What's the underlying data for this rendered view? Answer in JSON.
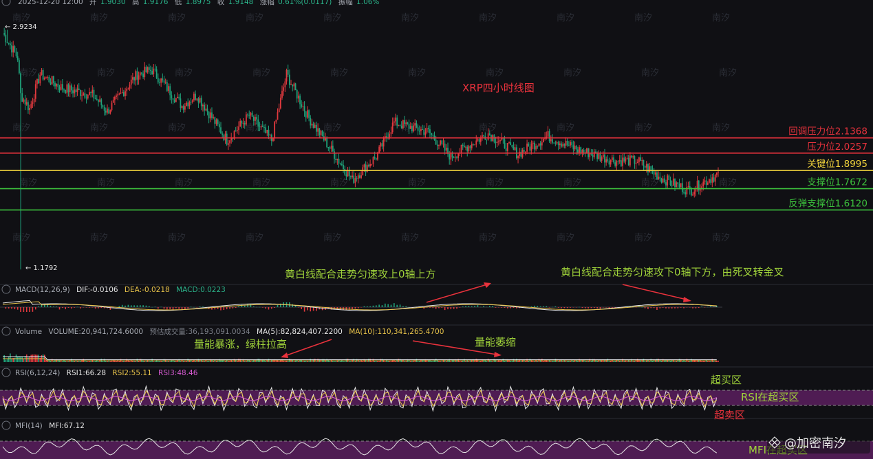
{
  "header": {
    "time": "2025-12-20 12:00",
    "open_label": "开",
    "open": "1.9030",
    "high_label": "高",
    "high": "1.9176",
    "low_label": "低",
    "low": "1.8975",
    "close_label": "收",
    "close": "1.9148",
    "change_label": "涨幅",
    "change": "0.61%(0.0117)",
    "amp_label": "振幅",
    "amp": "1.06%"
  },
  "chart_data": {
    "type": "candlestick",
    "title": "XRP四小时线图",
    "price_range": [
      1.1,
      3.0
    ],
    "max_label": "← 2.9234",
    "min_label": "← 1.1792",
    "max_price": 2.9234,
    "min_price": 1.1792,
    "candles_count": 300,
    "levels": [
      {
        "label": "回调压力位2.1368",
        "value": 2.1368,
        "color": "#e8323c"
      },
      {
        "label": "压力位2.0257",
        "value": 2.0257,
        "color": "#e8323c"
      },
      {
        "label": "关键位1.8995",
        "value": 1.8995,
        "color": "#f0d23c"
      },
      {
        "label": "支撑位1.7672",
        "value": 1.7672,
        "color": "#3cc03c"
      },
      {
        "label": "反弹支撑位1.6120",
        "value": 1.612,
        "color": "#3cc03c"
      }
    ],
    "anchors": [
      [
        0,
        2.9
      ],
      [
        10,
        2.72
      ],
      [
        12,
        2.45
      ],
      [
        18,
        2.35
      ],
      [
        25,
        2.6
      ],
      [
        40,
        2.5
      ],
      [
        60,
        2.45
      ],
      [
        70,
        2.33
      ],
      [
        90,
        2.6
      ],
      [
        100,
        2.63
      ],
      [
        120,
        2.37
      ],
      [
        130,
        2.45
      ],
      [
        150,
        2.12
      ],
      [
        165,
        2.3
      ],
      [
        180,
        2.12
      ],
      [
        190,
        2.6
      ],
      [
        205,
        2.28
      ],
      [
        218,
        2.08
      ],
      [
        234,
        1.83
      ],
      [
        250,
        2.0
      ],
      [
        262,
        2.25
      ],
      [
        285,
        2.18
      ],
      [
        300,
        2.0
      ],
      [
        325,
        2.17
      ],
      [
        345,
        2.02
      ],
      [
        365,
        2.15
      ],
      [
        385,
        2.05
      ],
      [
        410,
        1.97
      ],
      [
        425,
        1.97
      ],
      [
        440,
        1.85
      ],
      [
        450,
        1.8
      ],
      [
        460,
        1.75
      ],
      [
        467,
        1.8
      ],
      [
        480,
        1.88
      ]
    ],
    "macd": {
      "params": "MACD(12,26,9)",
      "dif_label": "DIF:",
      "dif": "-0.0106",
      "dea_label": "DEA:",
      "dea": "-0.0218",
      "macd_label": "MACD:",
      "macd": "0.0223"
    },
    "volume": {
      "label": "Volume",
      "volume": "VOLUME:20,941,724.6000",
      "est": "预估成交量:36,193,091.0034",
      "ma5": "MA(5):82,824,407.2200",
      "ma10": "MA(10):110,341,265.4700"
    },
    "rsi": {
      "params": "RSI(6,12,24)",
      "rsi1": "RSI1:66.28",
      "rsi2": "RSI2:55.11",
      "rsi3": "RSI3:48.46",
      "overbought": 80,
      "oversold": 20
    },
    "mfi": {
      "params": "MFI(14)",
      "mfi": "MFI:67.12"
    }
  },
  "annotations": {
    "macd_up": "黄白线配合走势匀速攻上0轴上方",
    "macd_down": "黄白线配合走势匀速攻下0轴下方，由死叉转金叉",
    "vol_up": "量能暴涨，绿柱拉高",
    "vol_down": "量能萎缩",
    "rsi_overbought": "超买区",
    "rsi_state": "RSI在超买区",
    "rsi_oversold": "超卖区",
    "mfi_state": "MFI在超买区"
  },
  "watermark": "南汐",
  "brand": "@加密南汐",
  "colors": {
    "up": "#e0393e",
    "down": "#1fa27a",
    "grid": "#22242b",
    "text": "#a7abb3",
    "yellow": "#e8c34a",
    "white": "#e6e6e6",
    "purple": "#d65ad1",
    "annot": "#9fd23a"
  }
}
